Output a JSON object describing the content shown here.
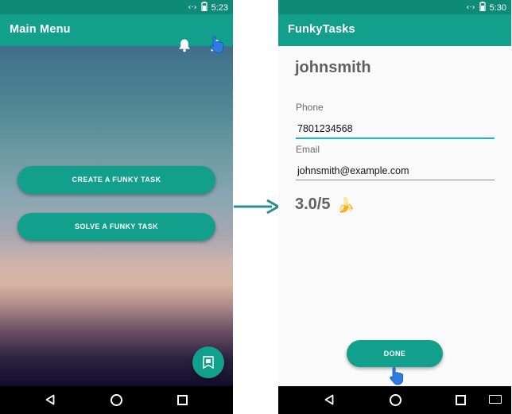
{
  "left_screen": {
    "status_time": "5:23",
    "appbar_title": "Main Menu",
    "buttons": {
      "create": "CREATE A FUNKY TASK",
      "solve": "SOLVE A FUNKY TASK"
    }
  },
  "right_screen": {
    "status_time": "5:30",
    "appbar_title": "FunkyTasks",
    "username": "johnsmith",
    "phone_label": "Phone",
    "phone_value": "7801234568",
    "email_label": "Email",
    "email_value": "johnsmith@example.com",
    "rating": "3.0/5",
    "rating_icon": "banana",
    "done_button": "DONE"
  },
  "colors": {
    "accent": "#12a08c",
    "input_focus": "#26b5c7",
    "arrow": "#2a8d92"
  },
  "icons": {
    "appbar_left": [
      "bell-icon",
      "person-icon"
    ],
    "fab": "bookmark-icon",
    "status": [
      "signal-icon",
      "battery-icon"
    ],
    "nav": [
      "back-icon",
      "home-icon",
      "recents-icon"
    ]
  }
}
